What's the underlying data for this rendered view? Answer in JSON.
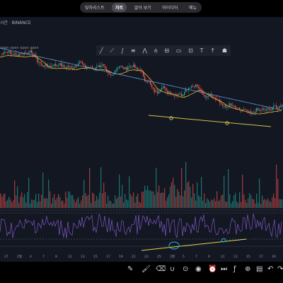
{
  "tabs": [
    "맞차리스트",
    "차트",
    "알아 보기",
    "아이디어",
    "메뉴"
  ],
  "active_tab": "차트",
  "symbol_label": "시간 · BINANCE",
  "legend_text": "open open open open",
  "drawing_tools": [
    "line-tool-icon",
    "ray-tool-icon",
    "brush-tool-icon",
    "fib-tool-icon",
    "pattern-tool-icon",
    "pitchfork-tool-icon",
    "channel-tool-icon",
    "rectangle-tool-icon",
    "measure-tool-icon",
    "text-tool-icon",
    "arrow-up-tool-icon",
    "icons-tool-icon"
  ],
  "x_axis_labels": [
    "27",
    "2월",
    "4",
    "7",
    "9",
    "11",
    "13",
    "15",
    "17",
    "19",
    "21",
    "23",
    "25",
    "3월",
    "5",
    "7",
    "9",
    "11",
    "13",
    "15",
    "17",
    "19"
  ],
  "bottom_toolbar": [
    "pencil-icon",
    "brush-icon",
    "eraser-icon",
    "magnet-icon",
    "lock-icon",
    "eye-icon",
    "alarm-icon",
    "replay-icon",
    "indicator-icon",
    "compare-icon",
    "trash-icon",
    "undo-icon",
    "redo-icon"
  ],
  "colors": {
    "up": "#26a69a",
    "down": "#ef5350",
    "ma1": "#f0b429",
    "ma2": "#5b9bd5",
    "trend": "#d4c14a",
    "rsi": "#7e57c2",
    "rsi_trend": "#e8d84a",
    "circle": "#2aa7e0"
  }
}
